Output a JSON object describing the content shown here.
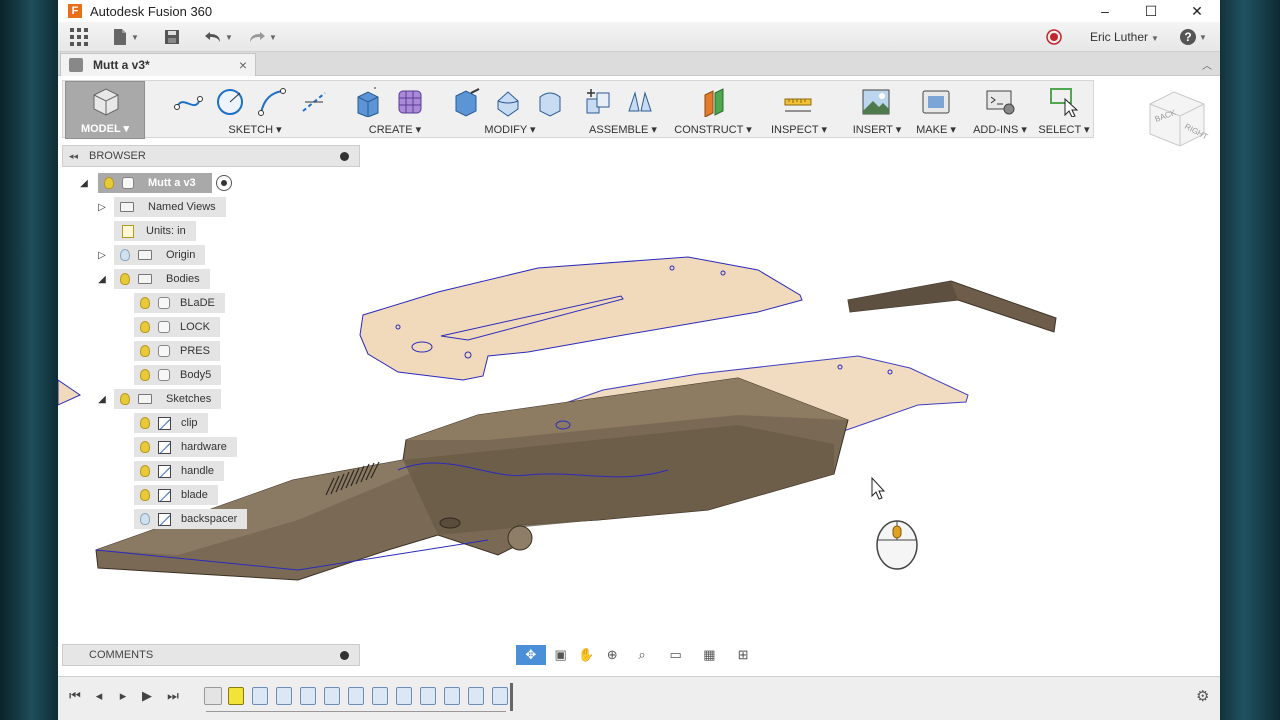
{
  "window": {
    "title": "Autodesk Fusion 360",
    "app_icon": "F",
    "minimize_icon": "–",
    "maximize_icon": "☐",
    "close_icon": "✕"
  },
  "appbar": {
    "user_name": "Eric Luther",
    "help_icon": "?"
  },
  "document_tab": {
    "title": "Mutt a v3*",
    "close": "×"
  },
  "toolbar": {
    "model_label": "MODEL ▾",
    "groups": [
      {
        "label": "SKETCH ▾"
      },
      {
        "label": "CREATE ▾"
      },
      {
        "label": "MODIFY ▾"
      },
      {
        "label": "ASSEMBLE ▾"
      },
      {
        "label": "CONSTRUCT ▾"
      },
      {
        "label": "INSPECT ▾"
      },
      {
        "label": "INSERT ▾"
      },
      {
        "label": "MAKE ▾"
      },
      {
        "label": "ADD-INS ▾"
      },
      {
        "label": "SELECT ▾"
      }
    ]
  },
  "browser": {
    "header": "BROWSER",
    "collapse_icon": "◂◂",
    "root": "Mutt a v3",
    "named_views": "Named Views",
    "units": "Units: in",
    "origin": "Origin",
    "bodies_folder": "Bodies",
    "bodies": [
      "BLaDE",
      "LOCK",
      "PRES",
      "Body5"
    ],
    "sketches_folder": "Sketches",
    "sketches": [
      "clip",
      "hardware",
      "handle",
      "blade",
      "backspacer"
    ]
  },
  "comments": {
    "header": "COMMENTS"
  },
  "viewcube": {
    "faces": [
      "BACK",
      "RIGHT"
    ]
  },
  "colors": {
    "accent": "#1e6fc8",
    "model_button": "#a9a9a9",
    "body_fill": "#7a6a55",
    "sketch_fill": "#f1d9bb",
    "sketch_line": "#2b2bbd"
  }
}
